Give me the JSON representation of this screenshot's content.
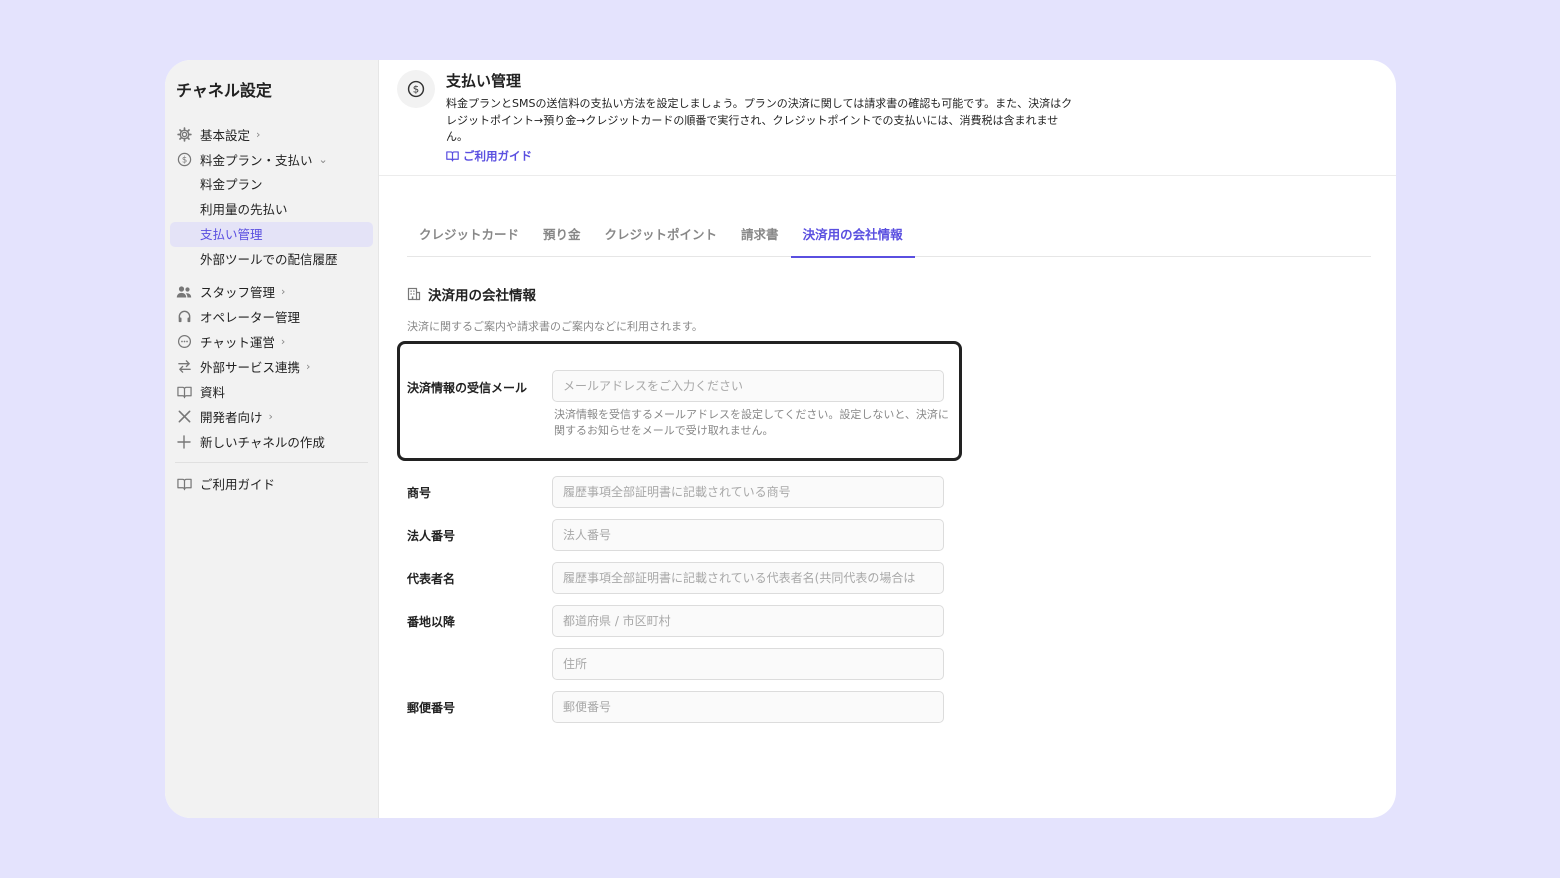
{
  "sidebar": {
    "title": "チャネル設定",
    "items": [
      {
        "label": "基本設定",
        "icon": "gear-icon"
      },
      {
        "label": "料金プラン・支払い",
        "icon": "dollar-circle-icon"
      },
      {
        "label": "スタッフ管理",
        "icon": "people-icon"
      },
      {
        "label": "オペレーター管理",
        "icon": "headset-icon"
      },
      {
        "label": "チャット運営",
        "icon": "chat-bubble-icon"
      },
      {
        "label": "外部サービス連携",
        "icon": "arrows-swap-icon"
      },
      {
        "label": "資料",
        "icon": "book-icon"
      },
      {
        "label": "開発者向け",
        "icon": "tools-icon"
      },
      {
        "label": "新しいチャネルの作成",
        "icon": "plus-icon"
      },
      {
        "label": "ご利用ガイド",
        "icon": "book-icon"
      }
    ],
    "subitems": [
      {
        "label": "料金プラン"
      },
      {
        "label": "利用量の先払い"
      },
      {
        "label": "支払い管理"
      },
      {
        "label": "外部ツールでの配信履歴"
      }
    ]
  },
  "header": {
    "title": "支払い管理",
    "description": "料金プランとSMSの送信料の支払い方法を設定しましょう。プランの決済に関しては請求書の確認も可能です。また、決済はクレジットポイント→預り金→クレジットカードの順番で実行され、クレジットポイントでの支払いには、消費税は含まれません。",
    "guide_link": "ご利用ガイド"
  },
  "tabs": [
    {
      "label": "クレジットカード"
    },
    {
      "label": "預り金"
    },
    {
      "label": "クレジットポイント"
    },
    {
      "label": "請求書"
    },
    {
      "label": "決済用の会社情報"
    }
  ],
  "active_tab": "決済用の会社情報",
  "section": {
    "title": "決済用の会社情報",
    "description": "決済に関するご案内や請求書のご案内などに利用されます。"
  },
  "form": {
    "email": {
      "label": "決済情報の受信メール",
      "value": "",
      "placeholder": "メールアドレスをご入力ください",
      "help": "決済情報を受信するメールアドレスを設定してください。設定しないと、決済に関するお知らせをメールで受け取れません。"
    },
    "company_name": {
      "label": "商号",
      "value": "",
      "placeholder": "履歴事項全部証明書に記載されている商号"
    },
    "corporate_number": {
      "label": "法人番号",
      "value": "",
      "placeholder": "法人番号"
    },
    "representative": {
      "label": "代表者名",
      "value": "",
      "placeholder": "履歴事項全部証明書に記載されている代表者名(共同代表の場合は"
    },
    "address": {
      "label": "番地以降",
      "value": "",
      "placeholder": "都道府県 / 市区町村"
    },
    "address2": {
      "value": "",
      "placeholder": "住所"
    },
    "postal_code": {
      "label": "郵便番号",
      "value": "",
      "placeholder": "郵便番号"
    }
  },
  "colors": {
    "accent": "#5a4fe0",
    "background": "#e4e3fd",
    "sidebar_bg": "#f2f2f2",
    "active_item_bg": "#e4e3f7"
  }
}
